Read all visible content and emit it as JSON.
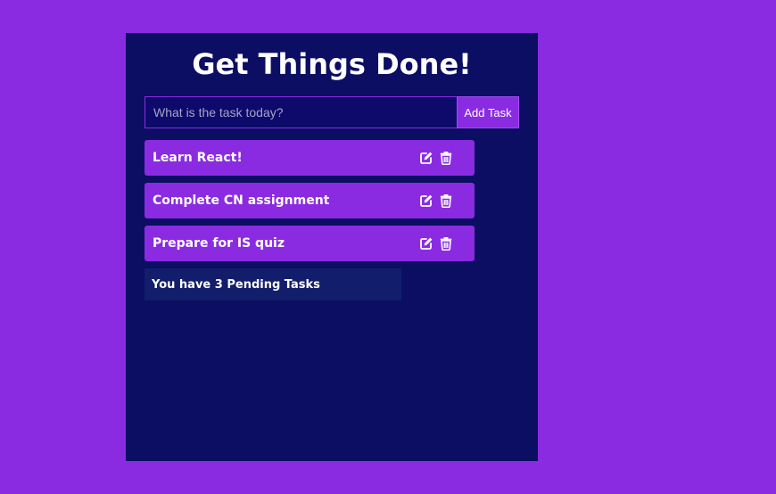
{
  "app": {
    "title": "Get Things Done!"
  },
  "form": {
    "input_value": "",
    "placeholder": "What is the task today?",
    "add_label": "Add Task"
  },
  "tasks": [
    {
      "label": "Learn React!",
      "edit_icon": "edit-icon",
      "delete_icon": "trash-icon"
    },
    {
      "label": "Complete CN assignment",
      "edit_icon": "edit-icon",
      "delete_icon": "trash-icon"
    },
    {
      "label": "Prepare for IS quiz",
      "edit_icon": "edit-icon",
      "delete_icon": "trash-icon"
    }
  ],
  "status": {
    "pending_text": "You have 3 Pending Tasks"
  },
  "colors": {
    "background": "#8a2be2",
    "panel": "#0b0e62",
    "task_item": "#8a2be2",
    "pending_box": "#121e6c",
    "text": "#ffffff"
  }
}
